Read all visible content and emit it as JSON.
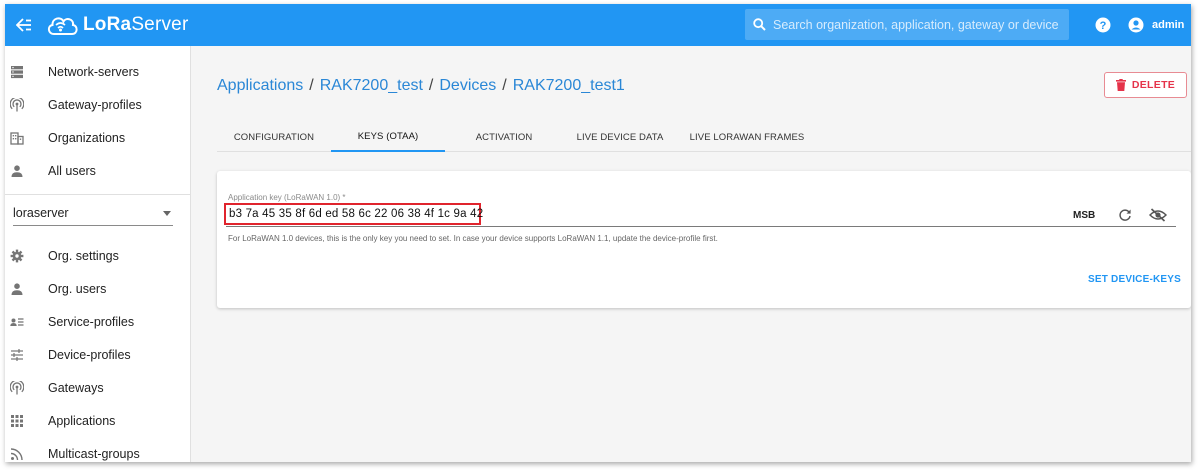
{
  "header": {
    "logo_text_bold": "LoRa",
    "logo_text_thin": "Server",
    "search_placeholder": "Search organization, application, gateway or device",
    "user": "admin"
  },
  "sidebar": {
    "top_items": [
      {
        "label": "Network-servers",
        "icon": "server-icon"
      },
      {
        "label": "Gateway-profiles",
        "icon": "broadcast-icon"
      },
      {
        "label": "Organizations",
        "icon": "building-icon"
      },
      {
        "label": "All users",
        "icon": "person-icon"
      }
    ],
    "org_select": "loraserver",
    "org_items": [
      {
        "label": "Org. settings",
        "icon": "gear-icon"
      },
      {
        "label": "Org. users",
        "icon": "person-icon"
      },
      {
        "label": "Service-profiles",
        "icon": "account-details-icon"
      },
      {
        "label": "Device-profiles",
        "icon": "tune-icon"
      },
      {
        "label": "Gateways",
        "icon": "broadcast-icon"
      },
      {
        "label": "Applications",
        "icon": "apps-grid-icon"
      },
      {
        "label": "Multicast-groups",
        "icon": "rss-icon"
      }
    ]
  },
  "breadcrumb": {
    "items": [
      "Applications",
      "RAK7200_test",
      "Devices",
      "RAK7200_test1"
    ],
    "separator": "/"
  },
  "delete_button": "DELETE",
  "tabs": [
    "CONFIGURATION",
    "KEYS (OTAA)",
    "ACTIVATION",
    "LIVE DEVICE DATA",
    "LIVE LORAWAN FRAMES"
  ],
  "active_tab": 1,
  "keys": {
    "app_key_label": "Application key (LoRaWAN 1.0) *",
    "app_key_value": "b3 7a 45 35 8f 6d ed 58 6c 22 06 38 4f 1c 9a 42",
    "byte_order": "MSB",
    "helper_text": "For LoRaWAN 1.0 devices, this is the only key you need to set. In case your device supports LoRaWAN 1.1, update the device-profile first.",
    "set_keys_button": "SET DEVICE-KEYS"
  },
  "colors": {
    "primary": "#2196f3",
    "danger": "#e5334a",
    "highlight_box": "#e0242d"
  }
}
